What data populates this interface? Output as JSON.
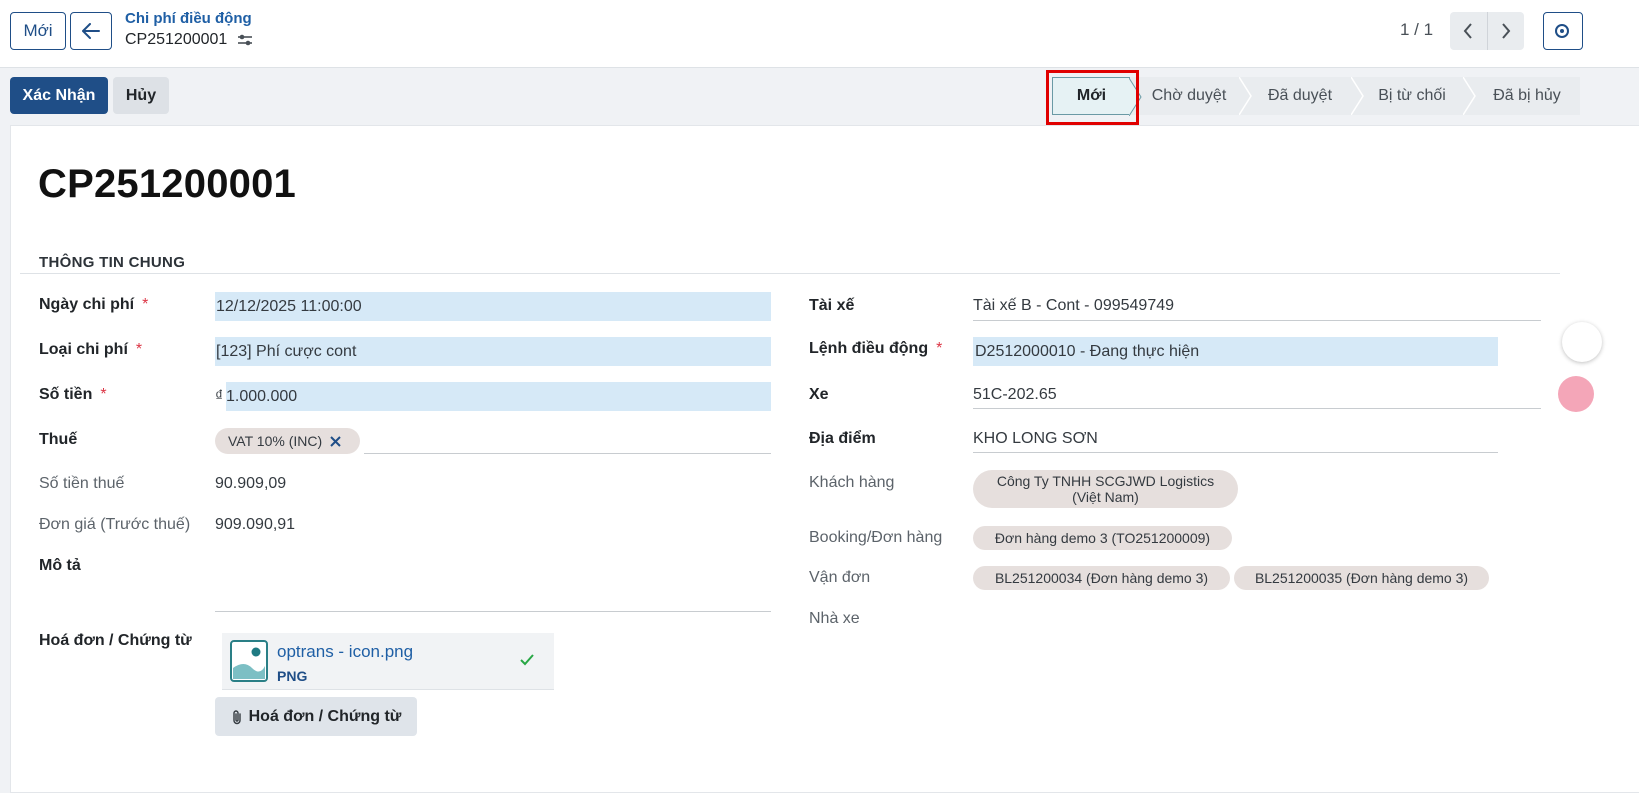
{
  "header": {
    "new_label": "Mới",
    "breadcrumb_parent": "Chi phí điều động",
    "breadcrumb_current": "CP251200001",
    "pager": "1 / 1"
  },
  "actions": {
    "confirm_label": "Xác Nhận",
    "cancel_label": "Hủy"
  },
  "status": {
    "stages": [
      "Mới",
      "Chờ duyệt",
      "Đã duyệt",
      "Bị từ chối",
      "Đã bị hủy"
    ],
    "active": "Mới"
  },
  "record": {
    "title": "CP251200001",
    "section": "THÔNG TIN CHUNG"
  },
  "left": {
    "date_label": "Ngày chi phí",
    "date_value": "12/12/2025 11:00:00",
    "type_label": "Loại chi phí",
    "type_value": "[123] Phí cược cont",
    "amount_label": "Số tiền",
    "amount_currency": "₫",
    "amount_value": "1.000.000",
    "tax_label": "Thuế",
    "tax_tag": "VAT 10% (INC)",
    "tax_amount_label": "Số tiền thuế",
    "tax_amount_value": "90.909,09",
    "unit_price_label": "Đơn giá (Trước thuế)",
    "unit_price_value": "909.090,91",
    "desc_label": "Mô tả",
    "invoice_label": "Hoá đơn / Chứng từ",
    "attachment_name": "optrans - icon.png",
    "attachment_type": "PNG",
    "attach_button": "Hoá đơn / Chứng từ"
  },
  "right": {
    "driver_label": "Tài xế",
    "driver_value": "Tài xế B - Cont - 099549749",
    "order_label": "Lệnh điều động",
    "order_value": "D2512000010 - Đang thực hiện",
    "vehicle_label": "Xe",
    "vehicle_value": "51C-202.65",
    "location_label": "Địa điểm",
    "location_value": "KHO LONG SƠN",
    "customer_label": "Khách hàng",
    "customer_line1": "Công Ty TNHH SCGJWD Logistics",
    "customer_line2": "(Việt Nam)",
    "booking_label": "Booking/Đơn hàng",
    "booking_tag": "Đơn hàng demo 3 (TO251200009)",
    "bl_label": "Vận đơn",
    "bl_tags": [
      "BL251200034 (Đơn hàng demo 3)",
      "BL251200035 (Đơn hàng demo 3)"
    ],
    "carrier_label": "Nhà xe"
  },
  "colors": {
    "primary": "#1f4e87",
    "field_highlight": "#d6e9f7",
    "tag_bg": "#e6dfdd",
    "required": "#dc3545"
  }
}
